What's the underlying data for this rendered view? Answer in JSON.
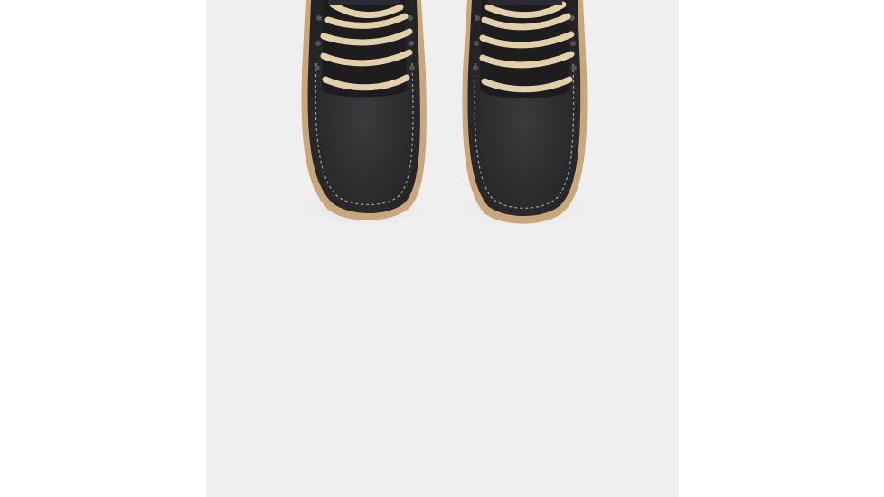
{
  "image": {
    "subject": "pair-of-black-lace-up-boots-top-view",
    "colors": {
      "page_background": "#ffffff",
      "panel_background": "#efefef",
      "boot_leather": "#2b2b2d",
      "boot_leather_highlight": "#3a3a3d",
      "sole": "#c9a77a",
      "laces": "#e3cfa8",
      "stitching": "#9a9a9a",
      "shadow": "#d6d6d6"
    }
  }
}
